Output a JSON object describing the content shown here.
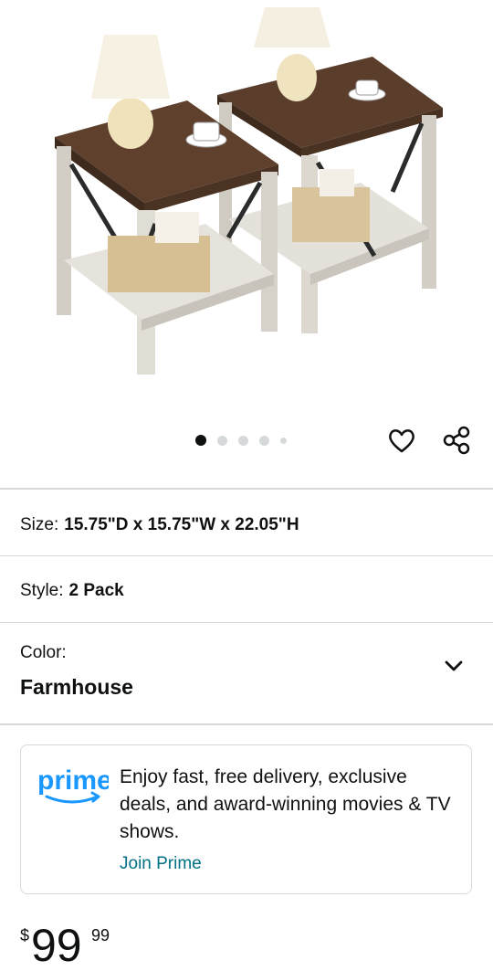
{
  "product": {
    "image_alt": "Two farmhouse end tables with lamps and cups"
  },
  "carousel": {
    "active_index": 0,
    "count": 5
  },
  "actions": {
    "favorite_icon": "heart-icon",
    "share_icon": "share-icon"
  },
  "attributes": {
    "size_label": "Size:",
    "size_value": "15.75\"D x 15.75\"W x 22.05\"H",
    "style_label": "Style:",
    "style_value": "2 Pack",
    "color_label": "Color:",
    "color_value": "Farmhouse"
  },
  "prime": {
    "logo_text": "prime",
    "message": "Enjoy fast, free delivery, exclusive deals, and award-winning movies & TV shows.",
    "join_label": "Join Prime",
    "brand_color": "#1a98ff"
  },
  "price": {
    "symbol": "$",
    "whole": "99",
    "fraction": "99"
  }
}
